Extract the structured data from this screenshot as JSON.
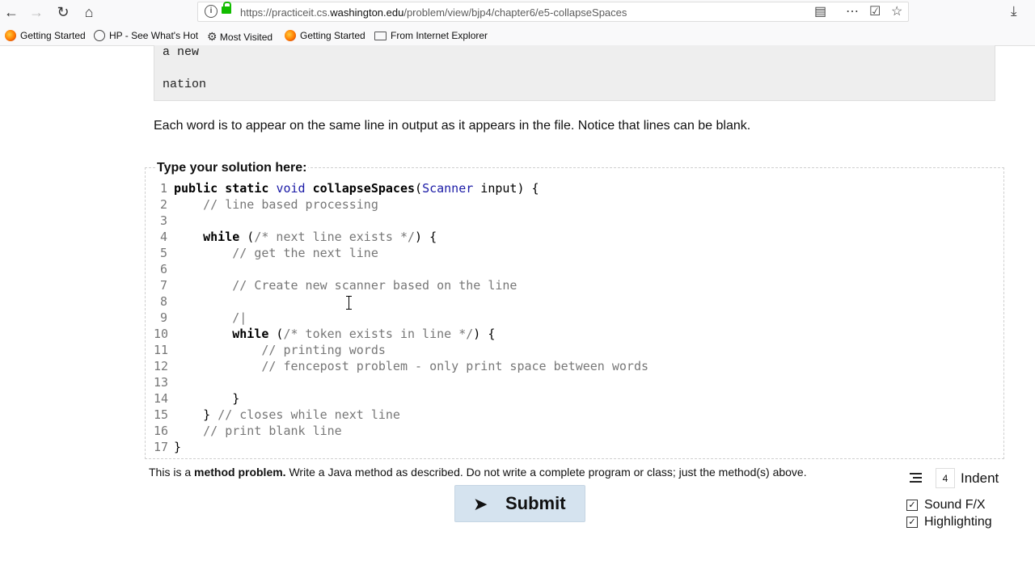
{
  "browser": {
    "url_prefix": "https://practiceit.cs.",
    "url_domain": "washington.edu",
    "url_path": "/problem/view/bjp4/chapter6/e5-collapseSpaces"
  },
  "bookmarks": [
    {
      "label": "Getting Started",
      "icon": "firefox-icon"
    },
    {
      "label": "HP - See What's Hot",
      "icon": "globe-icon"
    },
    {
      "label": "Most Visited",
      "icon": "gear-icon"
    },
    {
      "label": "Getting Started",
      "icon": "firefox-icon"
    },
    {
      "label": "From Internet Explorer",
      "icon": "folder-icon"
    }
  ],
  "output_sample": {
    "line1": "a new",
    "line2": "nation"
  },
  "description": "Each word is to appear on the same line in output as it appears in the file. Notice that lines can be blank.",
  "solution": {
    "label": "Type your solution here:",
    "code_lines": [
      "1",
      "2",
      "3",
      "4",
      "5",
      "6",
      "7",
      "8",
      "9",
      "10",
      "11",
      "12",
      "13",
      "14",
      "15",
      "16",
      "17"
    ],
    "line1": {
      "kw": "public static",
      "ty": "void",
      "fn": "collapseSpaces",
      "open": "(",
      "param_type": "Scanner",
      "rest": " input) {"
    },
    "line2": "// line based processing",
    "line4": {
      "kw": "while",
      "open": " (",
      "cm": "/* next line exists */",
      "close": ") {"
    },
    "line5": "// get the next line",
    "line7": "// Create new scanner based on the line",
    "line9": "/|",
    "line10": {
      "kw": "while",
      "open": " (",
      "cm": "/* token exists in line */",
      "close": ") {"
    },
    "line11": "// printing words",
    "line12": "// fencepost problem - only print space between words",
    "line14": "}",
    "line15": {
      "close": "} ",
      "cm": "// closes while next line"
    },
    "line16": "// print blank line",
    "line17": "}"
  },
  "note": {
    "prefix": "This is a ",
    "bold": "method problem.",
    "suffix": " Write a Java method as described. Do not write a complete program or class; just the method(s) above."
  },
  "submit_label": "Submit",
  "indent": {
    "value": "4",
    "label": "Indent"
  },
  "options": [
    {
      "label": "Sound F/X",
      "checked": true
    },
    {
      "label": "Highlighting",
      "checked": true
    }
  ],
  "colors": {
    "submit_bg": "#d5e3ef",
    "type_color": "#1a1aa6",
    "comment_color": "#777777",
    "lock_green": "#12bc00"
  }
}
